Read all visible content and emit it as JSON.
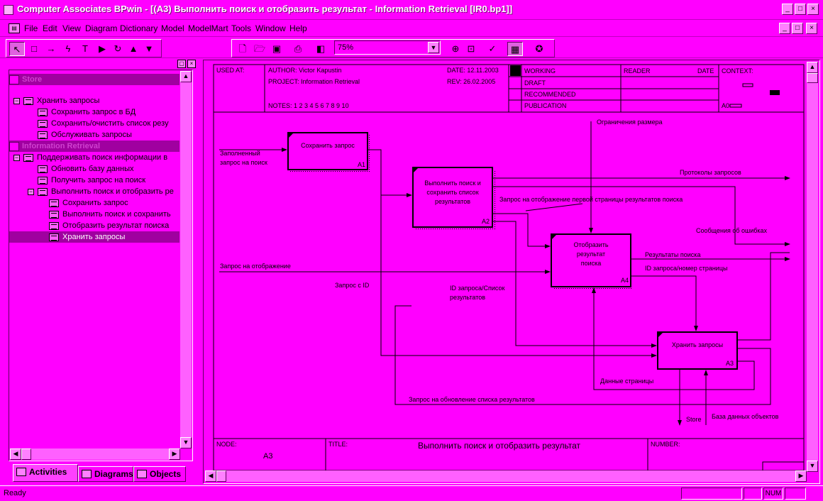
{
  "window": {
    "title": "Computer Associates BPwin - [(A3) Выполнить поиск и отобразить результат - Information Retrieval  [IR0.bp1]]",
    "min_glyph": "_",
    "max_glyph": "□",
    "close_glyph": "×"
  },
  "menu": {
    "items": [
      "File",
      "Edit",
      "View",
      "Diagram",
      "Dictionary",
      "Model",
      "ModelMart",
      "Tools",
      "Window",
      "Help"
    ]
  },
  "toolbar": {
    "zoom_value": "75%"
  },
  "tree": {
    "groups": [
      {
        "label": "Store",
        "children": [
          {
            "label": "Хранить запросы",
            "children": [
              {
                "label": "Сохранить запрос в БД"
              },
              {
                "label": "Сохранить/очистить  список  резу"
              },
              {
                "label": "Обслуживать запросы"
              }
            ]
          }
        ]
      },
      {
        "label": "Information Retrieval",
        "children": [
          {
            "label": "Поддерживать поиск информации  в",
            "children": [
              {
                "label": "Обновить базу данных"
              },
              {
                "label": "Получить запрос на поиск"
              },
              {
                "label": "Выполнить поиск и отобразить ре",
                "children": [
                  {
                    "label": "Сохранить запрос"
                  },
                  {
                    "label": "Выполнить поиск и  сохранить"
                  },
                  {
                    "label": "Отобразить  результат поиска"
                  },
                  {
                    "label": "Хранить запросы"
                  }
                ]
              }
            ]
          }
        ]
      }
    ]
  },
  "tabs": [
    "Activities",
    "Diagrams",
    "Objects"
  ],
  "header_frame": {
    "used_at": "USED AT:",
    "author": "AUTHOR:  Victor Kapustin",
    "date": "DATE:  12.11.2003",
    "project": "PROJECT:  Information Retrieval",
    "rev": "REV:     26.02.2005",
    "notes": "NOTES:  1  2  3  4  5  6  7  8  9  10",
    "status": [
      "WORKING",
      "DRAFT",
      "RECOMMENDED",
      "PUBLICATION"
    ],
    "reader": "READER",
    "reader_date": "DATE",
    "context": "CONTEXT:",
    "context_node": "A0"
  },
  "footer_frame": {
    "node_label": "NODE:",
    "node_value": "A3",
    "title_label": "TITLE:",
    "title_value": "Выполнить поиск и отобразить результат",
    "number_label": "NUMBER:"
  },
  "activities": [
    {
      "lines": [
        "Сохранить запрос"
      ],
      "num": "A1"
    },
    {
      "lines": [
        "Выполнить поиск и",
        "сохранить список",
        "результатов"
      ],
      "num": "A2"
    },
    {
      "lines": [
        "Отобразить",
        "результат",
        "поиска"
      ],
      "num": "A4"
    },
    {
      "lines": [
        "Хранить запросы"
      ],
      "num": "A3"
    }
  ],
  "arrows": {
    "size_limit": "Ограничения размера",
    "filled_query_1": "Заполненный",
    "filled_query_2": "запрос на поиск",
    "query_logs": "Протоколы запросов",
    "first_page_request": "Запрос на отображение первой страницы результатов поиска",
    "error_messages": "Сообщения об ошибках",
    "search_results": "Результаты поиска",
    "display_request": "Запрос на отображение",
    "query_page_id": "ID запроса/номер страницы",
    "query_with_id": "Запрос с ID",
    "query_id_list_1": "ID запроса/Список",
    "query_id_list_2": "результатов",
    "page_data": "Данные страницы",
    "results_update": "Запрос на обновление списка результатов",
    "store": "Store",
    "object_db": "База данных объектов"
  },
  "status": {
    "text": "Ready",
    "num": "NUM"
  }
}
